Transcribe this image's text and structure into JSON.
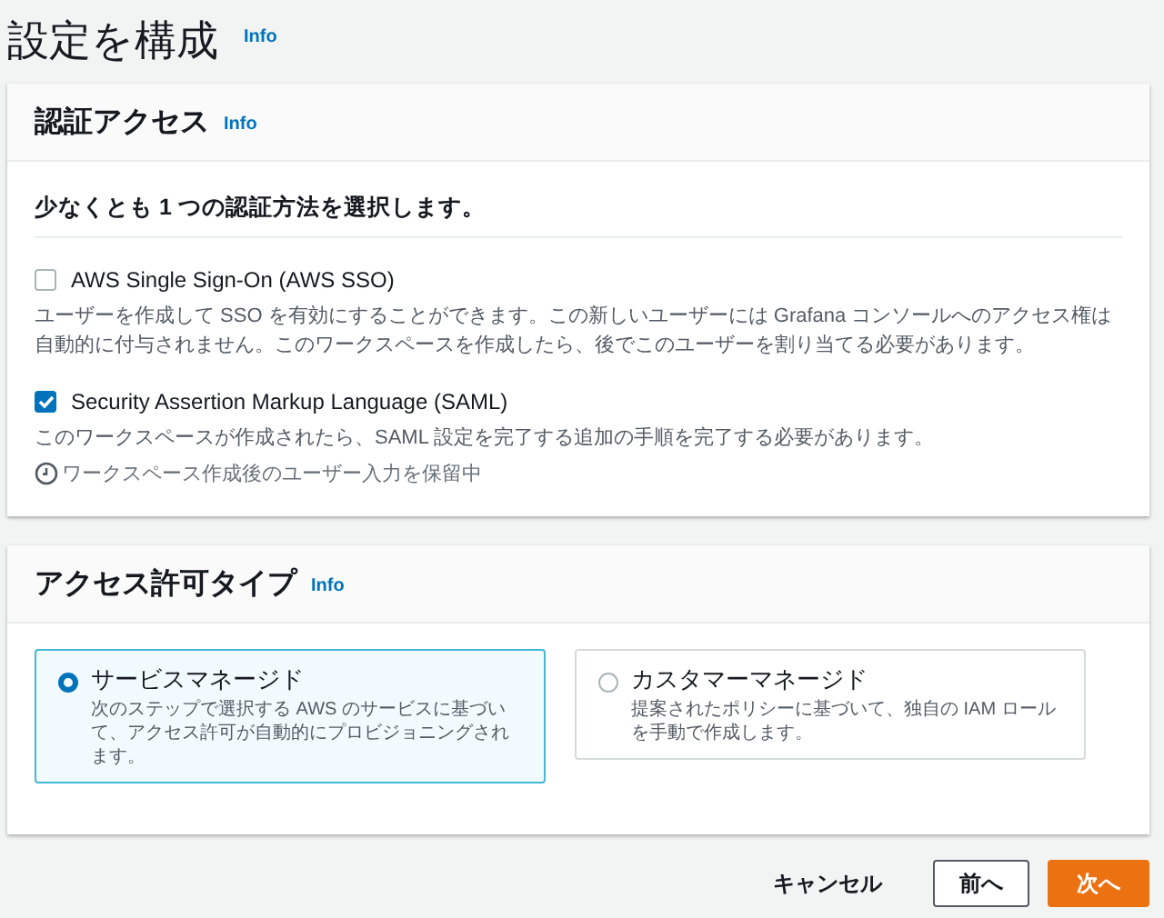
{
  "page": {
    "title": "設定を構成",
    "info": "Info"
  },
  "auth_panel": {
    "title": "認証アクセス",
    "info": "Info",
    "heading": "少なくとも 1 つの認証方法を選択します。",
    "options": [
      {
        "label": "AWS Single Sign-On (AWS SSO)",
        "checked": false,
        "description": "ユーザーを作成して SSO を有効にすることができます。この新しいユーザーには Grafana コンソールへのアクセス権は自動的に付与されません。このワークスペースを作成したら、後でこのユーザーを割り当てる必要があります。"
      },
      {
        "label": "Security Assertion Markup Language (SAML)",
        "checked": true,
        "description": "このワークスペースが作成されたら、SAML 設定を完了する追加の手順を完了する必要があります。",
        "status": "ワークスペース作成後のユーザー入力を保留中"
      }
    ]
  },
  "permission_panel": {
    "title": "アクセス許可タイプ",
    "info": "Info",
    "tiles": [
      {
        "label": "サービスマネージド",
        "selected": true,
        "description": "次のステップで選択する AWS のサービスに基づいて、アクセス許可が自動的にプロビジョニングされます。"
      },
      {
        "label": "カスタマーマネージド",
        "selected": false,
        "description": "提案されたポリシーに基づいて、独自の IAM ロールを手動で作成します。"
      }
    ]
  },
  "footer": {
    "buttons": [
      {
        "label": "キャンセル",
        "kind": "link"
      },
      {
        "label": "前へ",
        "kind": "normal"
      },
      {
        "label": "次へ",
        "kind": "primary"
      }
    ]
  }
}
